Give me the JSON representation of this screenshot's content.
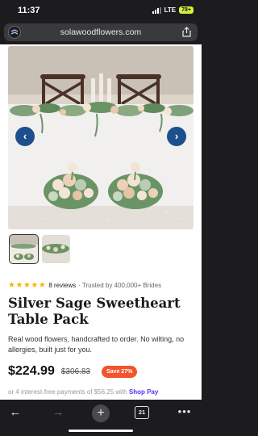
{
  "status_bar": {
    "time": "11:37",
    "network": "LTE",
    "battery": "78+"
  },
  "browser": {
    "url": "solawoodflowers.com"
  },
  "product": {
    "rating_stars": 5,
    "stars_text": "★★★★★",
    "reviews": "8 reviews",
    "trusted": "· Trusted by 400,000+ Brides",
    "title": "Silver Sage Sweetheart Table Pack",
    "description": "Real wood flowers, handcrafted to order. No wilting, no allergies, built just for you.",
    "price": "$224.99",
    "compare_price": "$306.83",
    "save_badge": "Save 27%",
    "installments_text": "or 4 interest-free payments of $56.25 with",
    "installments_provider": "Shop Pay"
  },
  "gallery": {
    "prev_label": "‹",
    "next_label": "›"
  },
  "toolbar": {
    "back": "←",
    "forward": "→",
    "new_tab": "+",
    "tab_count": "21",
    "more": "•••"
  },
  "colors": {
    "accent_blue": "#1d4f8f",
    "save_orange": "#f0552d",
    "star_gold": "#f5b50a",
    "shop_pay": "#5a31f4"
  }
}
